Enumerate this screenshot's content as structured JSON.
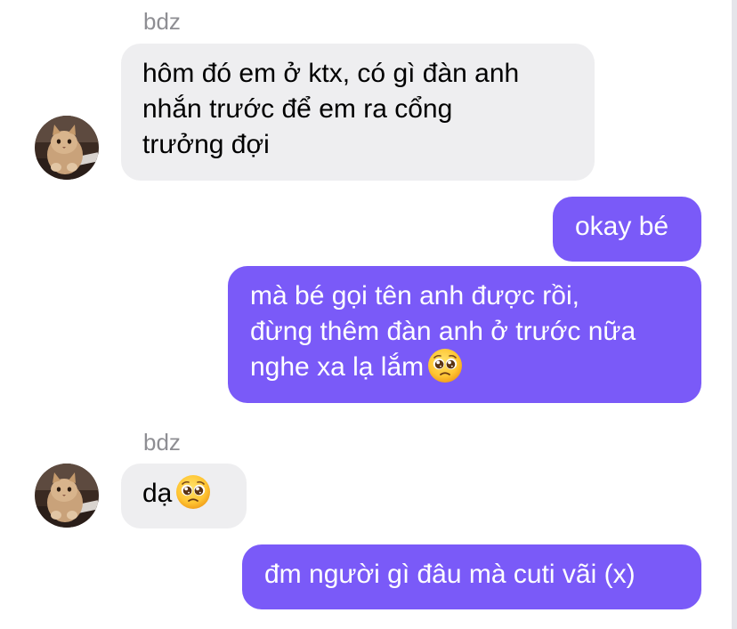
{
  "chat": {
    "messages": [
      {
        "direction": "incoming",
        "sender": "bdz",
        "avatar_icon": "cat-avatar",
        "lines": [
          "hôm đó em ở ktx, có gì đàn anh",
          "nhắn trước để em ra cổng",
          "trưởng đợi"
        ]
      },
      {
        "direction": "outgoing",
        "lines": [
          "okay bé"
        ]
      },
      {
        "direction": "outgoing",
        "lines": [
          "mà bé gọi tên anh được rồi,",
          "đừng thêm đàn anh ở trước nữa",
          "nghe xa lạ lắm"
        ],
        "emoji": "pleading-face-emoji"
      },
      {
        "direction": "incoming",
        "sender": "bdz",
        "avatar_icon": "cat-avatar",
        "lines": [
          "dạ"
        ],
        "emoji": "pleading-face-emoji"
      },
      {
        "direction": "outgoing",
        "lines": [
          "đm người gì đâu mà cuti vãi (x)"
        ]
      }
    ]
  },
  "colors": {
    "incoming_bubble": "#eeeef0",
    "outgoing_bubble": "#7a5af8",
    "sender_name": "#8e8e93",
    "background": "#ffffff"
  }
}
